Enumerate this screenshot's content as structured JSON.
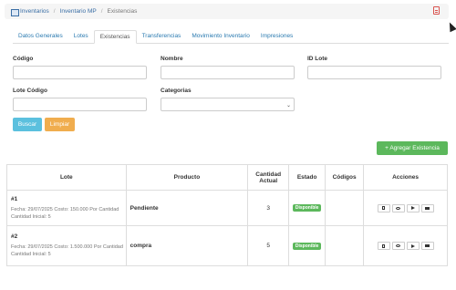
{
  "breadcrumb": {
    "items": [
      "Inventarios",
      "Inventario MP"
    ],
    "current": "Existencias"
  },
  "tabs": [
    "Datos Generales",
    "Lotes",
    "Existencias",
    "Transferencias",
    "Movimiento Inventario",
    "Impresiones"
  ],
  "active_tab": "Existencias",
  "filters": {
    "codigo_label": "Código",
    "nombre_label": "Nombre",
    "id_lote_label": "ID Lote",
    "lote_codigo_label": "Lote Código",
    "categorias_label": "Categorias",
    "codigo_value": "",
    "nombre_value": "",
    "id_lote_value": "",
    "lote_codigo_value": "",
    "categorias_value": ""
  },
  "buttons": {
    "buscar": "Buscar",
    "limpiar": "Limpiar",
    "agregar": "+ Agregar Existencia"
  },
  "table": {
    "headers": {
      "lote": "Lote",
      "producto": "Producto",
      "cantidad": "Cantidad Actual",
      "estado": "Estado",
      "codigos": "Códigos",
      "acciones": "Acciones"
    },
    "rows": [
      {
        "id": "#1",
        "fecha_costo": "Fecha: 29/07/2025 Costo: 150.000 Por Cantidad",
        "cantidad_inicial": "Cantidad Inicial: 5",
        "producto": "Pendiente",
        "cantidad": "3",
        "estado": "Disponible",
        "codigos": ""
      },
      {
        "id": "#2",
        "fecha_costo": "Fecha: 29/07/2025 Costo: 1.500.000 Por Cantidad",
        "cantidad_inicial": "Cantidad Inicial: 5",
        "producto": "compra",
        "cantidad": "5",
        "estado": "Disponible",
        "codigos": ""
      }
    ]
  },
  "icons": {
    "breadcrumb": "inventory-icon",
    "export": "pdf-icon",
    "row_actions": [
      "trash-icon",
      "eye-icon",
      "megaphone-icon",
      "print-icon"
    ]
  },
  "colors": {
    "info": "#5bc0de",
    "warning": "#f0ad4e",
    "success": "#5cb85c",
    "link": "#2a7ab0"
  }
}
